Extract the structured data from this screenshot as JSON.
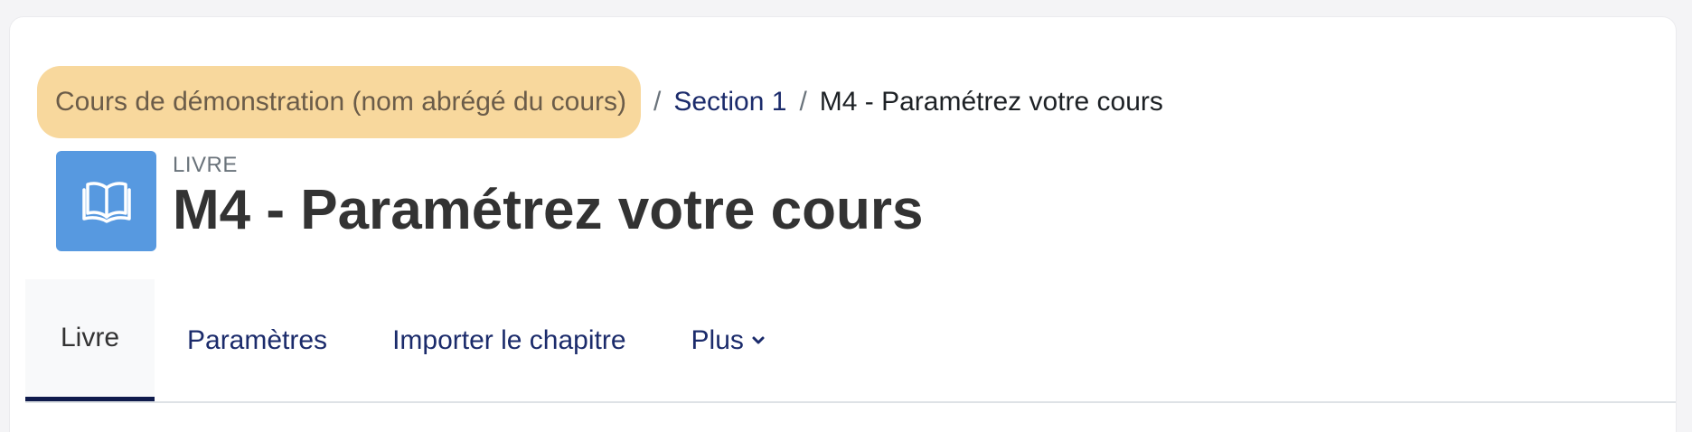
{
  "breadcrumb": {
    "course": "Cours de démonstration (nom abrégé du cours)",
    "separator": "/",
    "section": "Section 1",
    "current": "M4 - Paramétrez votre cours"
  },
  "header": {
    "activity_type": "LIVRE",
    "title": "M4 - Paramétrez votre cours",
    "icon": "book-icon",
    "icon_bg": "#5799e0"
  },
  "nav": {
    "tabs": [
      {
        "label": "Livre",
        "active": true
      },
      {
        "label": "Paramètres",
        "active": false
      },
      {
        "label": "Importer le chapitre",
        "active": false
      },
      {
        "label": "Plus",
        "active": false,
        "icon": "chevron-down-icon"
      }
    ]
  },
  "colors": {
    "highlight": "#f8d89d",
    "link": "#1b2b6b",
    "active_tab_border": "#0f1b4c"
  }
}
